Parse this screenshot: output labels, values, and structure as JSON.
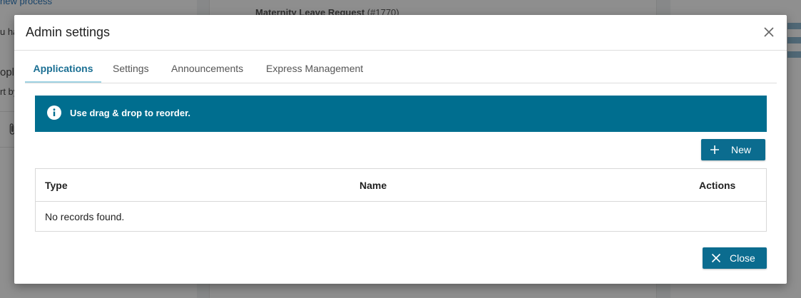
{
  "background": {
    "left_snippets": [
      "new process",
      "u ha",
      "oplic",
      "rt by"
    ],
    "request_title": "Maternity Leave Request",
    "request_number": "(#1770)"
  },
  "dialog": {
    "title": "Admin settings",
    "close_icon": "close-icon",
    "tabs": [
      {
        "label": "Applications",
        "active": true
      },
      {
        "label": "Settings",
        "active": false
      },
      {
        "label": "Announcements",
        "active": false
      },
      {
        "label": "Express Management",
        "active": false
      }
    ],
    "info_banner": {
      "icon": "info-icon",
      "text": "Use drag & drop to reorder."
    },
    "new_button": {
      "icon": "plus-icon",
      "label": "New"
    },
    "table": {
      "columns": [
        "Type",
        "Name",
        "Actions"
      ],
      "empty_message": "No records found."
    },
    "close_button": {
      "icon": "close-icon",
      "label": "Close"
    }
  },
  "colors": {
    "accent": "#006e8f",
    "button": "#0b6c8f",
    "active_tab_text": "#1a6f93",
    "active_tab_underline": "#9fd2e3"
  }
}
